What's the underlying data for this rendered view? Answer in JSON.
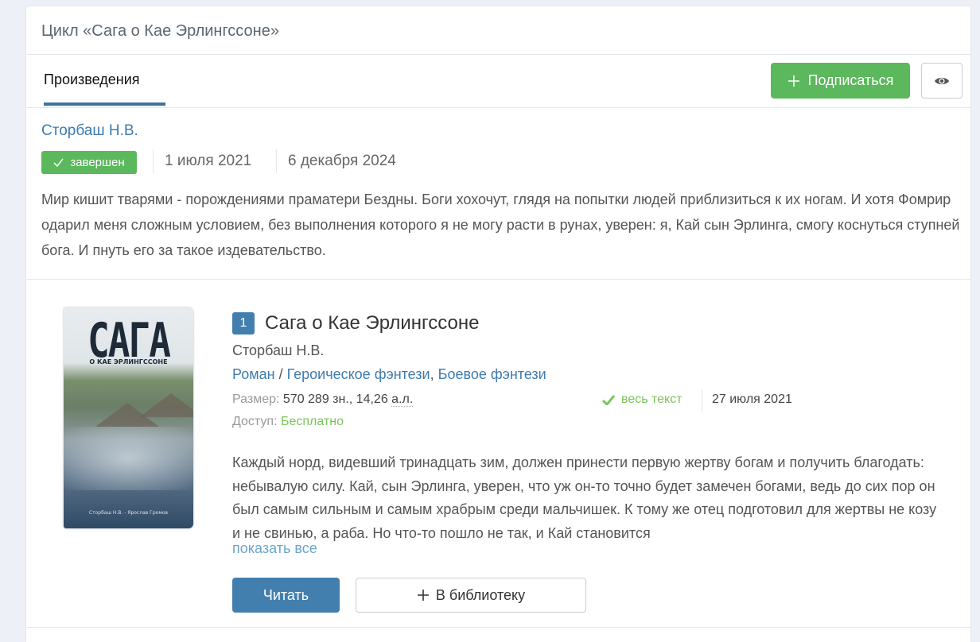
{
  "header": {
    "title": "Цикл «Сага о Кае Эрлингссоне»"
  },
  "tabs": [
    {
      "label": "Произведения",
      "active": true
    }
  ],
  "actions": {
    "subscribe_label": "Подписаться",
    "subscribe_icon": "plus-icon",
    "watch_icon": "eye-icon"
  },
  "series": {
    "author": "Сторбаш Н.В.",
    "status": "завершен",
    "start_date": "1 июля 2021",
    "update_date": "6 декабря 2024",
    "description": "Мир кишит тварями - порождениями праматери Бездны. Боги хохочут, глядя на попытки людей приблизиться к их ногам. И хотя Фомрир одарил меня сложным условием, без выполнения которого я не могу расти в рунах, уверен: я, Кай сын Эрлинга, смогу коснуться ступней бога. И пнуть его за такое издевательство."
  },
  "works": [
    {
      "number": "1",
      "title": "Сага о Кае Эрлингссоне",
      "author": "Сторбаш Н.В.",
      "form": "Роман",
      "genres": [
        "Героическое фэнтези",
        "Боевое фэнтези"
      ],
      "size_label": "Размер:",
      "size_value": "570 289 зн., 14,26 ",
      "size_unit": "а.л.",
      "completion": "весь текст",
      "date": "27 июля 2021",
      "access_label": "Доступ:",
      "access_value": "Бесплатно",
      "annotation": "Каждый норд, видевший тринадцать зим, должен принести первую жертву богам и получить благодать: небывалую силу. Кай, сын Эрлинга, уверен, что уж он-то точно будет замечен богами, ведь до сих пор он был самым сильным и самым храбрым среди мальчишек. К тому же отец подготовил для жертвы не козу и не свинью, а раба. Но что-то пошло не так, и Кай становится",
      "show_more": "показать все",
      "read_label": "Читать",
      "library_label": "В библиотеку",
      "cover": {
        "title": "САГА",
        "subtitle": "О КАЕ ЭРЛИНГССОНЕ",
        "credits": "Сторбаш Н.В. - Ярослав Громов"
      }
    }
  ],
  "colors": {
    "primary": "#437fae",
    "success": "#5cb85c",
    "link": "#3d7bb0"
  }
}
